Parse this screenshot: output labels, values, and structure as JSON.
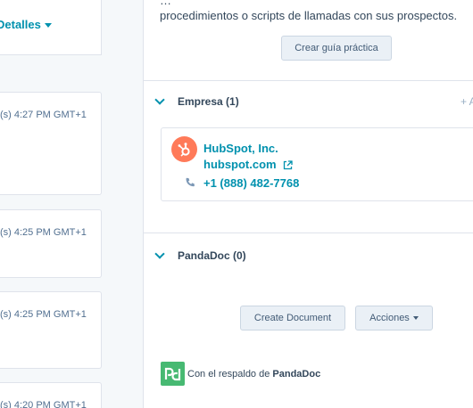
{
  "activity": {
    "details_label": "Detalles",
    "items": [
      {
        "time": "(s) 4:27 PM GMT+1"
      },
      {
        "time": "(s) 4:25 PM GMT+1"
      },
      {
        "time": "(s) 4:25 PM GMT+1"
      },
      {
        "time": "(s) 4:20 PM GMT+1"
      }
    ]
  },
  "sidebar": {
    "intro_line1": "…",
    "intro_line2": "procedimientos o scripts de llamadas con sus prospectos.",
    "create_guide_label": "Crear guía práctica",
    "company_section": {
      "title": "Empresa (1)",
      "add_label": "+ A",
      "company": {
        "name": "HubSpot, Inc.",
        "domain": "hubspot.com",
        "phone": "+1 (888) 482-7768"
      }
    },
    "pandadoc_section": {
      "title": "PandaDoc (0)",
      "create_document_label": "Create Document",
      "actions_label": "Acciones",
      "backed_by_prefix": "Con el respaldo de",
      "backed_by_brand": "PandaDoc"
    }
  },
  "colors": {
    "accent": "#0091ae",
    "hubspot_orange": "#ff7a59",
    "pandadoc_green": "#47b972"
  },
  "icons": [
    "chevron-down-icon",
    "external-link-icon",
    "phone-icon",
    "caret-down-icon",
    "hubspot-logo",
    "pandadoc-logo"
  ]
}
